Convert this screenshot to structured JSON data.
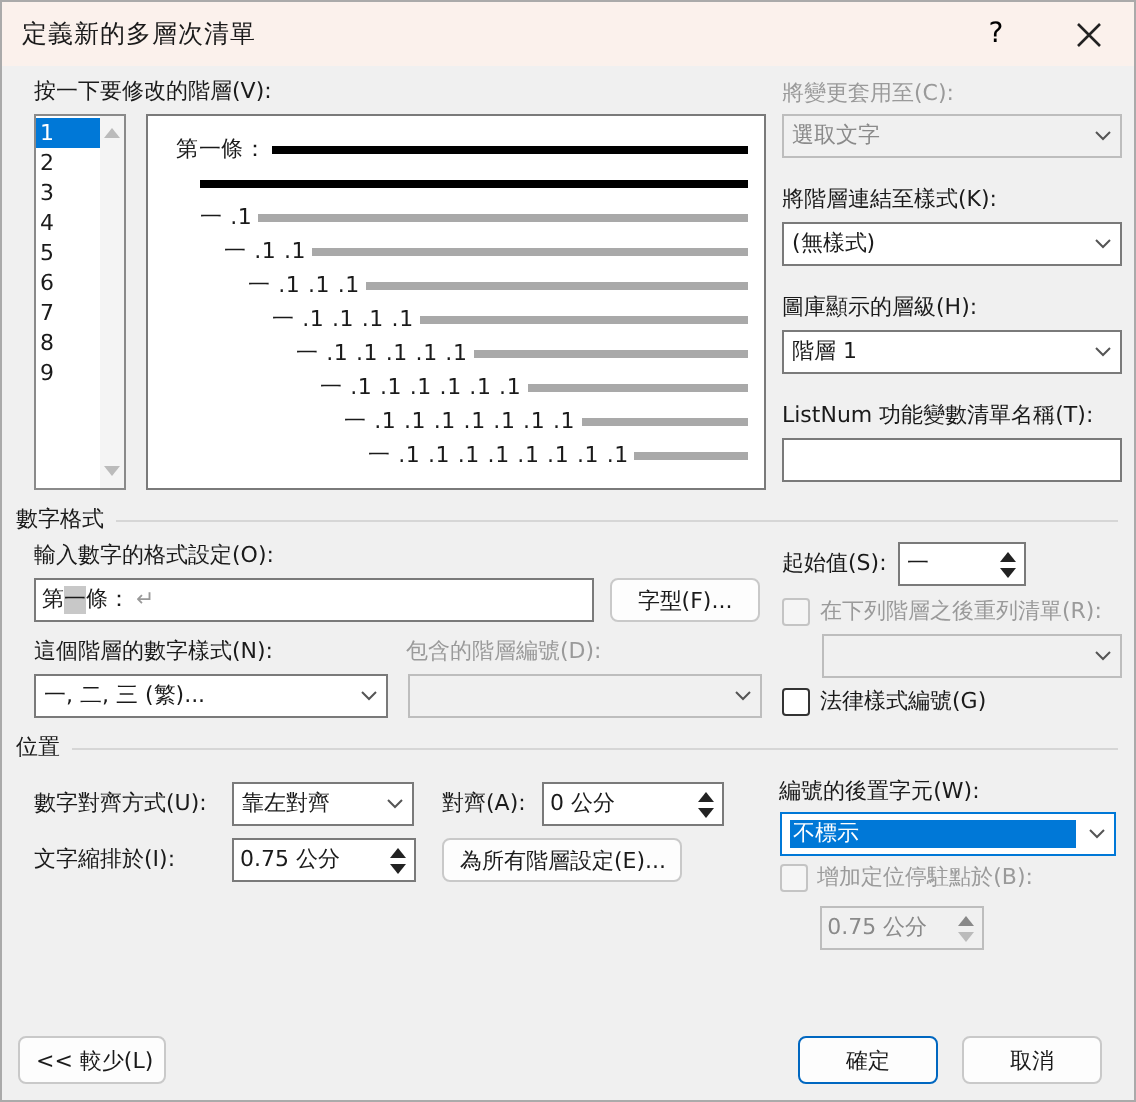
{
  "window": {
    "title": "定義新的多層次清單",
    "help": "?"
  },
  "level_list": {
    "label": "按一下要修改的階層(V):",
    "items": [
      {
        "label": "1",
        "selected": true
      },
      {
        "label": "2",
        "selected": false
      },
      {
        "label": "3",
        "selected": false
      },
      {
        "label": "4",
        "selected": false
      },
      {
        "label": "5",
        "selected": false
      },
      {
        "label": "6",
        "selected": false
      },
      {
        "label": "7",
        "selected": false
      },
      {
        "label": "8",
        "selected": false
      },
      {
        "label": "9",
        "selected": false
      }
    ]
  },
  "preview": {
    "rows": [
      {
        "kind": "active",
        "text": "第一條："
      },
      {
        "kind": "active"
      },
      {
        "kind": "sample",
        "text": "一 .1"
      },
      {
        "kind": "sample",
        "text": "一 .1 .1"
      },
      {
        "kind": "sample",
        "text": "一 .1 .1 .1"
      },
      {
        "kind": "sample",
        "text": "一 .1 .1 .1 .1"
      },
      {
        "kind": "sample",
        "text": "一 .1 .1 .1 .1 .1"
      },
      {
        "kind": "sample",
        "text": "一 .1 .1 .1 .1 .1 .1"
      },
      {
        "kind": "sample",
        "text": "一 .1 .1 .1 .1 .1 .1 .1"
      },
      {
        "kind": "sample",
        "text": "一 .1 .1 .1 .1 .1 .1 .1 .1"
      }
    ]
  },
  "apply_to": {
    "label": "將變更套用至(C):",
    "value": "選取文字",
    "disabled": true
  },
  "link_style": {
    "label": "將階層連結至樣式(K):",
    "value": "(無樣式)"
  },
  "gallery_level": {
    "label": "圖庫顯示的層級(H):",
    "value": "階層 1"
  },
  "listnum": {
    "label": "ListNum 功能變數清單名稱(T):"
  },
  "number_format": {
    "title": "數字格式",
    "format_input": {
      "label": "輸入數字的格式設定(O):",
      "parts": [
        {
          "kind": "text",
          "text": "第"
        },
        {
          "kind": "field",
          "text": "一"
        },
        {
          "kind": "text",
          "text": "條："
        },
        {
          "kind": "mark",
          "text": "↵"
        }
      ]
    },
    "font_button": "字型(F)...",
    "start_at": {
      "label": "起始值(S):",
      "value": "一"
    },
    "restart": {
      "label": "在下列階層之後重列清單(R):",
      "checked": false,
      "disabled": true
    },
    "number_style": {
      "label": "這個階層的數字樣式(N):",
      "value": "一, 二, 三 (繁)..."
    },
    "include_level": {
      "label": "包含的階層編號(D):",
      "disabled": true
    },
    "legal": {
      "label": "法律樣式編號(G)",
      "checked": false
    }
  },
  "position": {
    "title": "位置",
    "alignment": {
      "label": "數字對齊方式(U):",
      "value": "靠左對齊"
    },
    "aligned_at": {
      "label": "對齊(A):",
      "value": "0 公分"
    },
    "text_indent": {
      "label": "文字縮排於(I):",
      "value": "0.75 公分"
    },
    "set_all_button": "為所有階層設定(E)...",
    "follow_with": {
      "label": "編號的後置字元(W):",
      "value": "不標示",
      "selected": true
    },
    "tab_stop": {
      "label": "增加定位停駐點於(B):",
      "checked": false,
      "disabled": true,
      "value": "0.75 公分"
    }
  },
  "buttons": {
    "less": "<< 較少(L)",
    "ok": "確定",
    "cancel": "取消"
  }
}
